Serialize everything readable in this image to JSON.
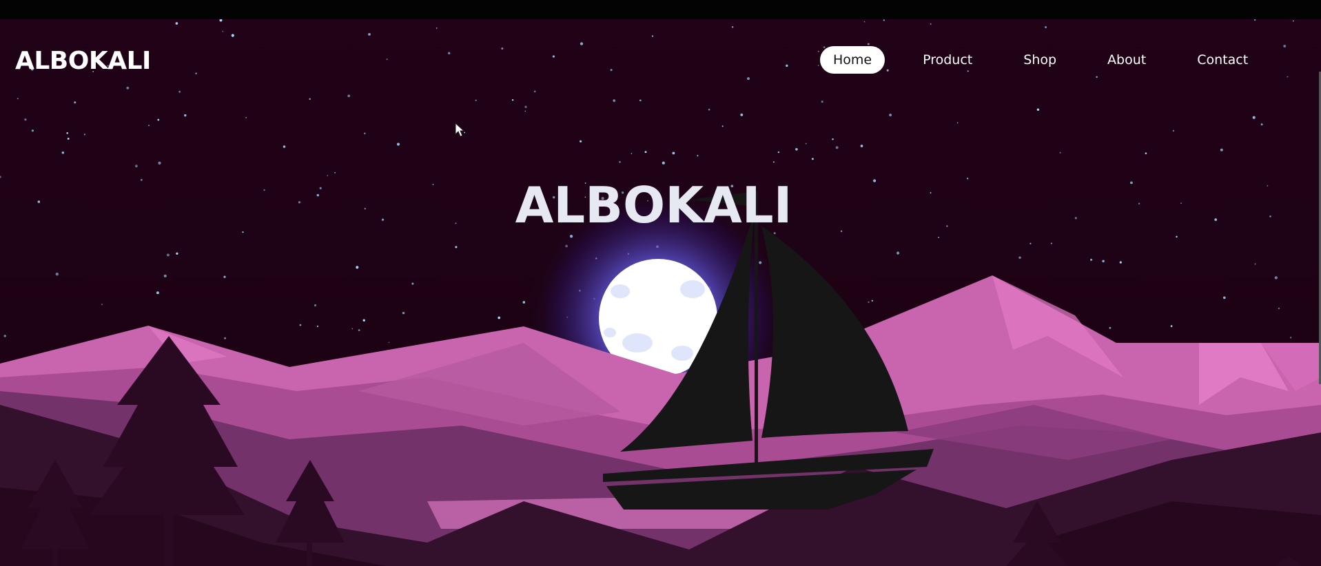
{
  "header": {
    "brand": "ALBOKALI",
    "nav": [
      {
        "label": "Home",
        "active": true
      },
      {
        "label": "Product",
        "active": false
      },
      {
        "label": "Shop",
        "active": false
      },
      {
        "label": "About",
        "active": false
      },
      {
        "label": "Contact",
        "active": false
      }
    ]
  },
  "hero": {
    "title": "ALBOKALI"
  },
  "colors": {
    "sky": "#1e0214",
    "mountain_light": "#d067b3",
    "mountain_mid": "#a54a8f",
    "mountain_dark": "#5b2553",
    "foreground": "#2e0a24",
    "moon": "#ffffff",
    "moon_glow": "#6b63d6",
    "sail": "#161616"
  }
}
